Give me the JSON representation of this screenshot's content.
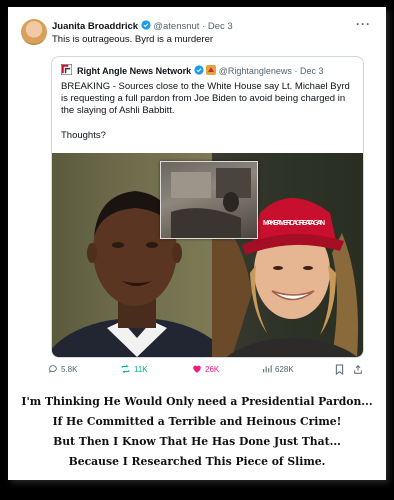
{
  "tweet": {
    "author_name": "Juanita Broaddrick",
    "handle": "@atensnut",
    "date": "Dec 3",
    "text": "This is outrageous.  Byrd is a murderer"
  },
  "quote": {
    "author_name": "Right Angle News Network",
    "handle": "@Rightanglenews",
    "date": "Dec 3",
    "body": "BREAKING - Sources close to the White House say Lt. Michael Byrd is requesting a full pardon from Joe Biden to avoid being charged in the slaying of Ashli Babbitt.",
    "thoughts": "Thoughts?",
    "hat_text": "MAKE AMERICA GREAT AGAIN"
  },
  "actions": {
    "replies": "5.8K",
    "reposts": "11K",
    "likes": "26K",
    "views": "628K"
  },
  "caption": {
    "line1": "I'm Thinking He Would Only need a Presidential Pardon...",
    "line2": "If He Committed a Terrible and Heinous Crime!",
    "line3": "But Then I Know That He Has Done Just That...",
    "line4": "Because I Researched This Piece of Slime."
  },
  "colors": {
    "verified_blue": "#1d9bf0",
    "repost_green": "#00ba7c",
    "like_red": "#f91880",
    "hat_red": "#c8102e"
  }
}
